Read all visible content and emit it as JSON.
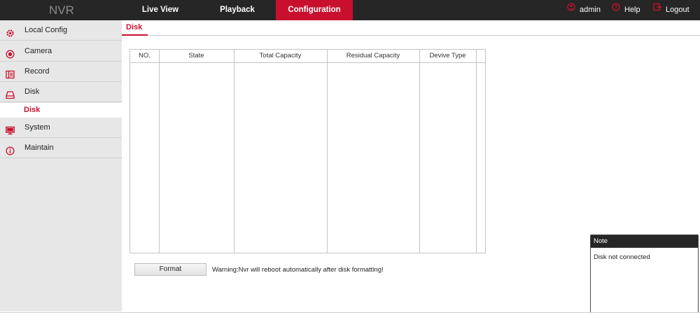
{
  "header": {
    "brand": "NVR",
    "nav": {
      "live_view": "Live View",
      "playback": "Playback",
      "configuration": "Configuration"
    },
    "user": "admin",
    "help": "Help",
    "logout": "Logout",
    "active_color": "#c8102e"
  },
  "sidebar": {
    "items": [
      {
        "label": "Local Config",
        "icon": "gear-icon"
      },
      {
        "label": "Camera",
        "icon": "camera-icon"
      },
      {
        "label": "Record",
        "icon": "record-icon"
      },
      {
        "label": "Disk",
        "icon": "disk-icon"
      },
      {
        "label": "System",
        "icon": "monitor-icon"
      },
      {
        "label": "Maintain",
        "icon": "info-icon"
      }
    ],
    "active_sub": "Disk"
  },
  "main": {
    "tab": "Disk",
    "table": {
      "columns": [
        "NO.",
        "State",
        "Total Capacity",
        "Residual Capacity",
        "Devive Type"
      ],
      "rows": []
    },
    "format_button": "Format",
    "warning": "Warning:Nvr will reboot automatically after disk formatting!"
  },
  "note": {
    "title": "Note",
    "message": "Disk not connected"
  }
}
